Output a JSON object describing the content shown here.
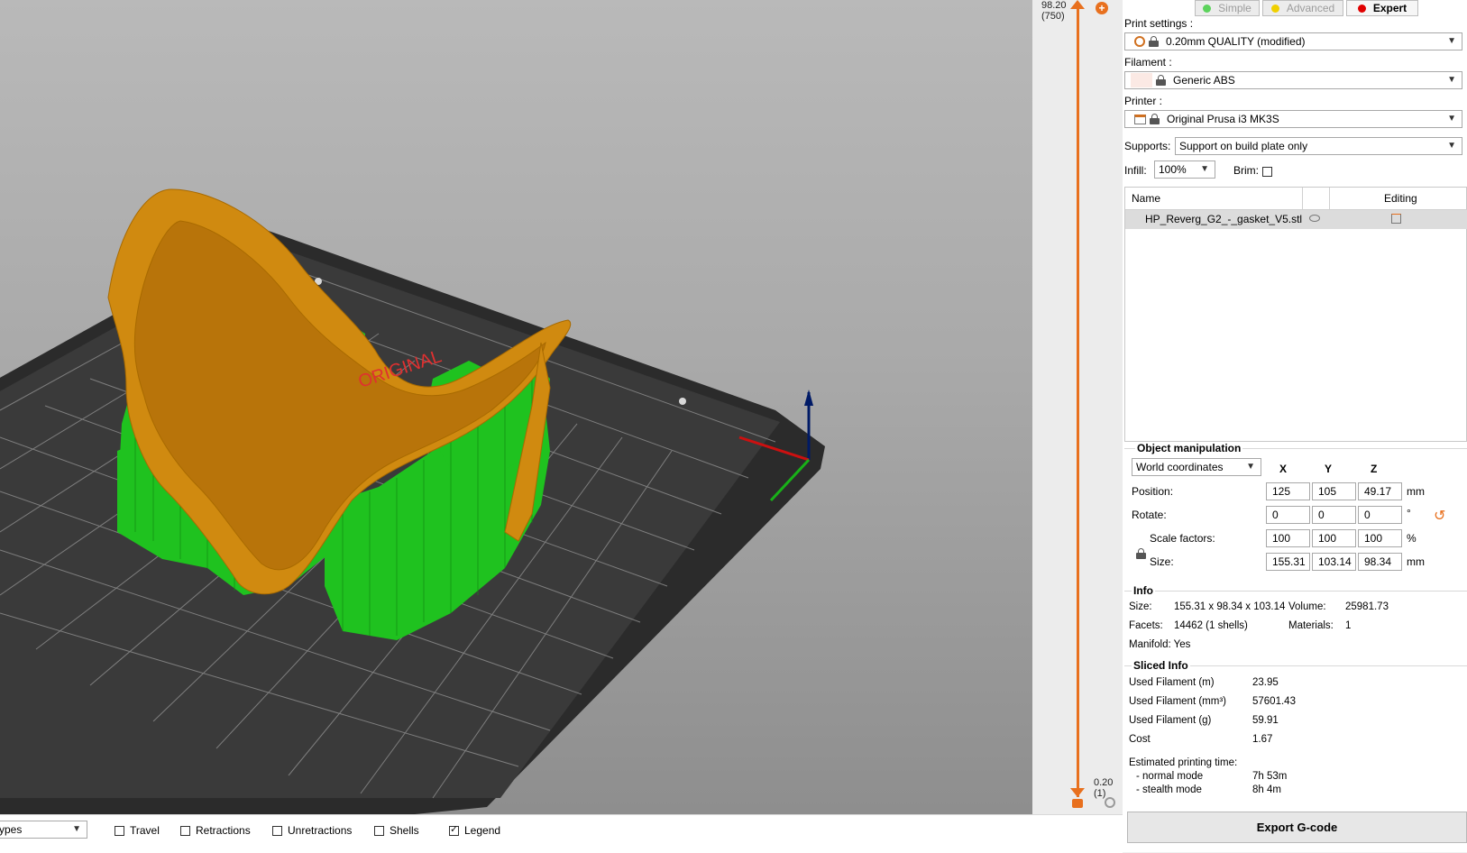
{
  "viewport": {
    "bed_label": "ORIGINAL"
  },
  "layer_slider": {
    "top_value": "98.20",
    "top_layer": "(750)",
    "bottom_value": "0.20",
    "bottom_layer": "(1)"
  },
  "modes": {
    "simple": "Simple",
    "advanced": "Advanced",
    "expert": "Expert",
    "colors": {
      "simple": "#5cd35c",
      "advanced": "#f0d000",
      "expert": "#e00000"
    }
  },
  "settings": {
    "print_label": "Print settings :",
    "print_value": "0.20mm QUALITY (modified)",
    "filament_label": "Filament :",
    "filament_value": "Generic ABS",
    "printer_label": "Printer :",
    "printer_value": "Original Prusa i3 MK3S",
    "supports_label": "Supports:",
    "supports_value": "Support on build plate only",
    "infill_label": "Infill:",
    "infill_value": "100%",
    "brim_label": "Brim:"
  },
  "object_list": {
    "col_name": "Name",
    "col_editing": "Editing",
    "items": [
      {
        "name": "HP_Reverg_G2_-_gasket_V5.stl"
      }
    ]
  },
  "manipulation": {
    "title": "Object manipulation",
    "coords_value": "World coordinates",
    "x": "X",
    "y": "Y",
    "z": "Z",
    "position_label": "Position:",
    "position": [
      "125",
      "105",
      "49.17"
    ],
    "position_unit": "mm",
    "rotate_label": "Rotate:",
    "rotate": [
      "0",
      "0",
      "0"
    ],
    "rotate_unit": "°",
    "scale_label": "Scale factors:",
    "scale": [
      "100",
      "100",
      "100"
    ],
    "scale_unit": "%",
    "size_label": "Size:",
    "size": [
      "155.31",
      "103.14",
      "98.34"
    ],
    "size_unit": "mm"
  },
  "info": {
    "title": "Info",
    "size_label": "Size:",
    "size_value": "155.31 x 98.34 x 103.14",
    "volume_label": "Volume:",
    "volume_value": "25981.73",
    "facets_label": "Facets:",
    "facets_value": "14462 (1 shells)",
    "materials_label": "Materials:",
    "materials_value": "1",
    "manifold": "Manifold: Yes"
  },
  "sliced": {
    "title": "Sliced Info",
    "rows": [
      {
        "label": "Used Filament (m)",
        "value": "23.95"
      },
      {
        "label": "Used Filament (mm³)",
        "value": "57601.43"
      },
      {
        "label": "Used Filament (g)",
        "value": "59.91"
      },
      {
        "label": "Cost",
        "value": "1.67"
      }
    ],
    "time_label": "Estimated printing time:",
    "normal_label": "- normal mode",
    "normal_value": "7h 53m",
    "stealth_label": "- stealth mode",
    "stealth_value": "8h 4m"
  },
  "export_label": "Export G-code",
  "bottom": {
    "view_type": "ypes",
    "travel": "Travel",
    "retractions": "Retractions",
    "unretractions": "Unretractions",
    "shells": "Shells",
    "legend": "Legend"
  }
}
